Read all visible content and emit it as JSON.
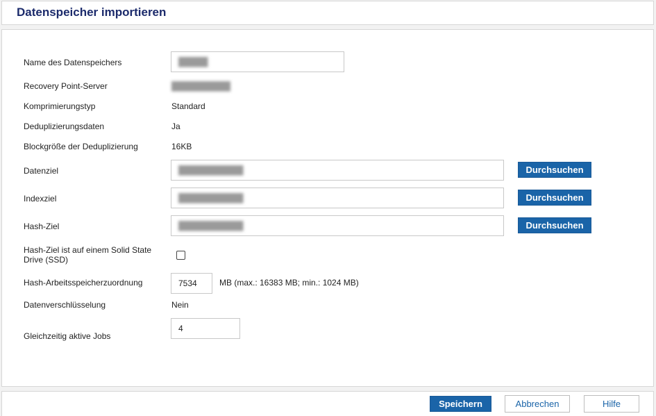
{
  "page": {
    "title": "Datenspeicher importieren"
  },
  "form": {
    "name": {
      "label": "Name des Datenspeichers",
      "value": "█████"
    },
    "rps": {
      "label": "Recovery Point-Server",
      "value": "██████████"
    },
    "compression": {
      "label": "Komprimierungstyp",
      "value": "Standard"
    },
    "dedupe": {
      "label": "Deduplizierungsdaten",
      "value": "Ja"
    },
    "blocksize": {
      "label": "Blockgröße der Deduplizierung",
      "value": "16KB"
    },
    "data_dest": {
      "label": "Datenziel",
      "value": "███████████",
      "browse": "Durchsuchen"
    },
    "index_dest": {
      "label": "Indexziel",
      "value": "███████████",
      "browse": "Durchsuchen"
    },
    "hash_dest": {
      "label": "Hash-Ziel",
      "value": "███████████",
      "browse": "Durchsuchen"
    },
    "ssd": {
      "label_line1": "Hash-Ziel ist auf einem Solid State",
      "label_line2": "Drive (SSD)",
      "checked": false
    },
    "hash_mem": {
      "label": "Hash-Arbeitsspeicherzuordnung",
      "value": "7534",
      "hint": "MB (max.: 16383 MB; min.: 1024 MB)"
    },
    "encryption": {
      "label": "Datenverschlüsselung",
      "value": "Nein"
    },
    "concurrent_jobs": {
      "label": "Gleichzeitig aktive Jobs",
      "value": "4"
    }
  },
  "footer": {
    "save": "Speichern",
    "cancel": "Abbrechen",
    "help": "Hilfe"
  },
  "colors": {
    "title": "#1b2a6b",
    "primary_button": "#1a64a8"
  }
}
